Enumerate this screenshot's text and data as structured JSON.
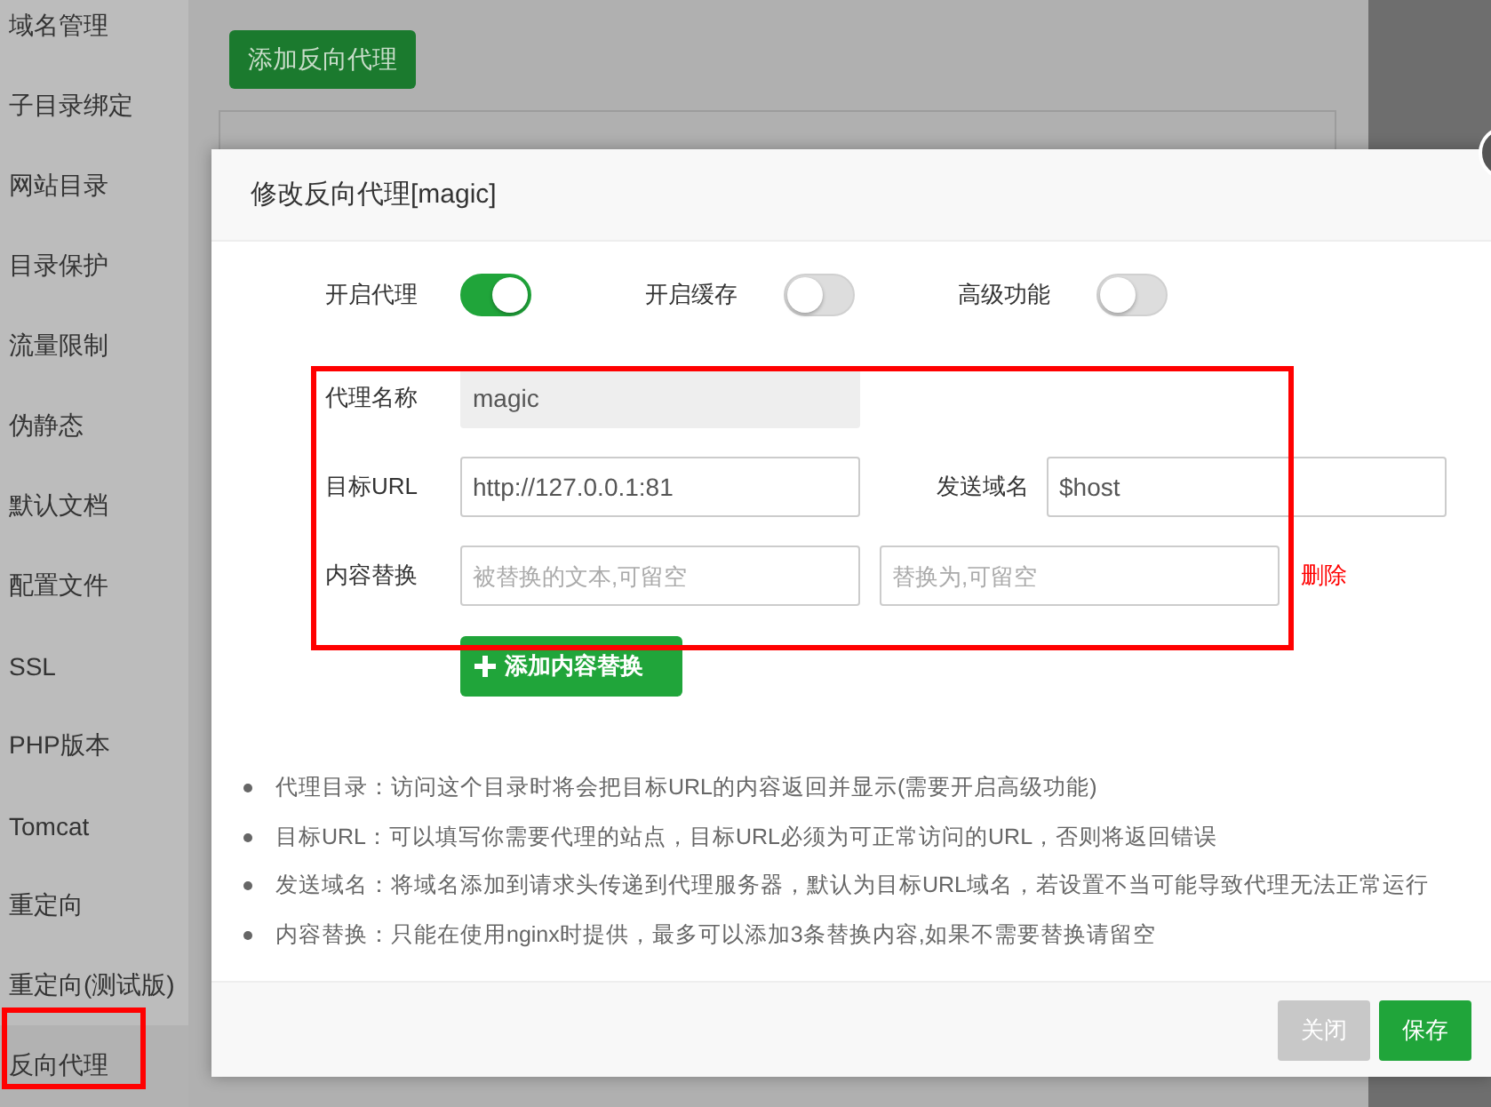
{
  "sidebar": {
    "items": [
      {
        "label": "域名管理"
      },
      {
        "label": "子目录绑定"
      },
      {
        "label": "网站目录"
      },
      {
        "label": "目录保护"
      },
      {
        "label": "流量限制"
      },
      {
        "label": "伪静态"
      },
      {
        "label": "默认文档"
      },
      {
        "label": "配置文件"
      },
      {
        "label": "SSL"
      },
      {
        "label": "PHP版本"
      },
      {
        "label": "Tomcat"
      },
      {
        "label": "重定向"
      },
      {
        "label": "重定向(测试版)"
      },
      {
        "label": "反向代理"
      }
    ]
  },
  "page": {
    "add_button": "添加反向代理"
  },
  "dialog": {
    "title": "修改反向代理[magic]",
    "toggles": [
      {
        "label": "开启代理",
        "on": true
      },
      {
        "label": "开启缓存",
        "on": false
      },
      {
        "label": "高级功能",
        "on": false
      }
    ],
    "name_field": {
      "label": "代理名称",
      "value": "magic",
      "disabled": true
    },
    "target_field": {
      "label": "目标URL",
      "value": "http://127.0.0.1:81"
    },
    "host_field": {
      "label": "发送域名",
      "value": "$host"
    },
    "replace": {
      "label": "内容替换",
      "from_placeholder": "被替换的文本,可留空",
      "to_placeholder": "替换为,可留空",
      "delete": "删除"
    },
    "add_replace_button": "添加内容替换",
    "notes": [
      "代理目录：访问这个目录时将会把目标URL的内容返回并显示(需要开启高级功能)",
      "目标URL：可以填写你需要代理的站点，目标URL必须为可正常访问的URL，否则将返回错误",
      "发送域名：将域名添加到请求头传递到代理服务器，默认为目标URL域名，若设置不当可能导致代理无法正常运行",
      "内容替换：只能在使用nginx时提供，最多可以添加3条替换内容,如果不需要替换请留空"
    ],
    "buttons": [
      {
        "label": "关闭",
        "kind": "secondary"
      },
      {
        "label": "保存",
        "kind": "primary"
      }
    ]
  }
}
